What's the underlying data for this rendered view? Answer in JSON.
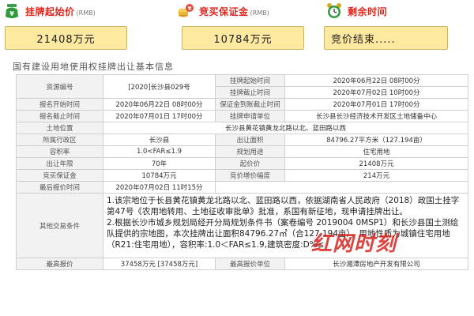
{
  "stats": {
    "start_price_label": "挂牌起始价",
    "start_price_unit": "(RMB)",
    "start_price_value": "21408万元",
    "deposit_label": "竞买保证金",
    "deposit_unit": "(RMB)",
    "deposit_value": "10784万元",
    "remaining_label": "剩余时间",
    "remaining_value": "竞价结束....."
  },
  "section_title": "国有建设用地使用权挂牌出让基本信息",
  "rows": {
    "r1": {
      "k1": "资源编号",
      "v1": "[2020]长沙县029号",
      "k2": "挂牌起始时间",
      "v2": "2020年06月22日 08时00分"
    },
    "r2": {
      "k2": "挂牌截止时间",
      "v2": "2020年07月02日 10时00分"
    },
    "r3": {
      "k1": "报名开始时间",
      "v1": "2020年06月22日 08时00分",
      "k2": "保证金到账截止时间",
      "v2": "2020年07月01日 17时00分"
    },
    "r4": {
      "k1": "报名截止时间",
      "v1": "2020年07月01日 17时00分",
      "k2": "挂牌申请单位",
      "v2": "长沙县长沙经济技术开发区土地储备中心"
    },
    "r5": {
      "k1": "土地位置",
      "v1": "长沙县黄花镇黄龙北路以北、蓝田路以西"
    },
    "r6": {
      "k1": "所属行政区",
      "v1": "长沙县",
      "k2": "出让面积",
      "v2": "84796.27平方米（127.194亩）"
    },
    "r7": {
      "k1": "容积率",
      "v1": "1.0<FAR≤1.9",
      "k2": "规划用途",
      "v2": "住宅用地"
    },
    "r8": {
      "k1": "出让年限",
      "v1": "70年",
      "k2": "起价价",
      "v2": "21408万元"
    },
    "r9": {
      "k1": "竞买保证金",
      "v1": "10784万元",
      "k2": "竞价增价幅度",
      "v2": "214万元"
    },
    "r10": {
      "k1": "最后报价时间",
      "v1": "2020年07月02日 11时15分"
    },
    "r11": {
      "k1": "其他交易条件",
      "p1": "1.该宗地位于长县黄花镇黄龙北路以北、蓝田路以西，依据湖南省人民政府（2018）政国土挂字第47号《农用地转用、土地征收审批单》批准，系国有新征地，现申请挂牌出让。",
      "p2": "2.根据长沙市城乡规划局经开分局规划条件书（案卷编号 2019004 0MSP1）和长沙县国土测绘队提供的宗地图，本次挂牌出让面积84796.27㎡（合127.194亩），用地性质为城镇住宅用地（R21:住宅用地），容积率:1.0＜FAR≤1.9,建筑密度:D%≤"
    },
    "r12": {
      "k1": "最高报价",
      "v1": "37458万元 [37458万元]",
      "k2": "最高报价单位",
      "v2": "长沙湘潭房地产开发有限公司"
    }
  },
  "watermark": "红网时刻",
  "colors": {
    "accent_red": "#e0261c",
    "box_fill": "#fde9a0",
    "box_border": "#c9b36a",
    "key_cell": "#f2f2f2"
  },
  "icons": [
    "money-bag-icon",
    "coins-deposit-icon",
    "alarm-clock-icon"
  ]
}
